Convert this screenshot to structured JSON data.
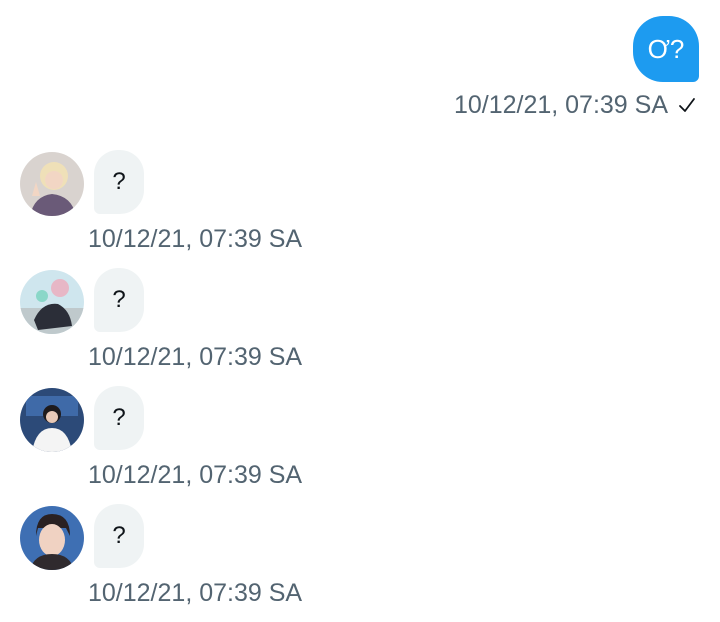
{
  "sent": {
    "text": "Ơ?",
    "timestamp": "10/12/21, 07:39 SA",
    "status_icon": "check-icon"
  },
  "received": [
    {
      "text": "?",
      "timestamp": "10/12/21, 07:39 SA",
      "avatar": "avatar-1"
    },
    {
      "text": "?",
      "timestamp": "10/12/21, 07:39 SA",
      "avatar": "avatar-2"
    },
    {
      "text": "?",
      "timestamp": "10/12/21, 07:39 SA",
      "avatar": "avatar-3"
    },
    {
      "text": "?",
      "timestamp": "10/12/21, 07:39 SA",
      "avatar": "avatar-4"
    }
  ],
  "colors": {
    "sent_bubble": "#1d9bf0",
    "received_bubble": "#eff3f4",
    "meta_text": "#536471"
  }
}
